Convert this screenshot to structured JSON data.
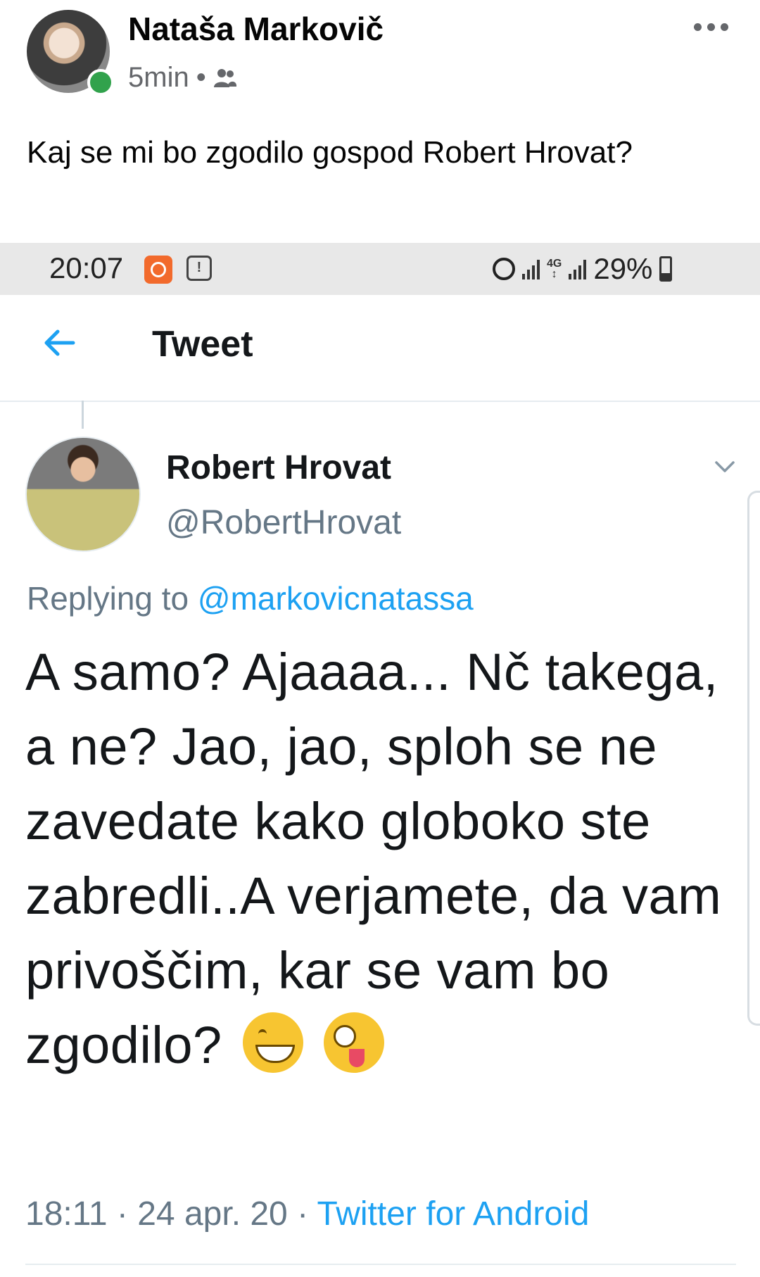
{
  "post": {
    "author_name": "Nataša Markovič",
    "time": "5min",
    "separator": "•",
    "audience_icon": "friends-icon",
    "more_icon": "more-horizontal-icon",
    "text": "Kaj se mi bo zgodilo gospod Robert Hrovat?"
  },
  "status_bar": {
    "time": "20:07",
    "network": "4G",
    "battery": "29%"
  },
  "tweet_view": {
    "title": "Tweet",
    "back_icon": "arrow-left-icon",
    "author_name": "Robert Hrovat",
    "author_handle": "@RobertHrovat",
    "replying_prefix": "Replying to",
    "replying_mention": "@markovicnatassa",
    "body": "A samo? Ajaaaa... Nč takega, a ne? Jao, jao, sploh se ne zavedate kako globoko ste zabredli..A verjamete, da vam privoščim, kar se vam bo zgodilo?",
    "emojis": [
      "grinning-face-emoji",
      "zany-face-emoji"
    ],
    "time": "18:11",
    "date": "24 apr. 20",
    "separator": "·",
    "client": "Twitter for Android"
  },
  "colors": {
    "twitter_blue": "#1da1f2",
    "muted_gray": "#657786",
    "online_green": "#31a24c"
  }
}
